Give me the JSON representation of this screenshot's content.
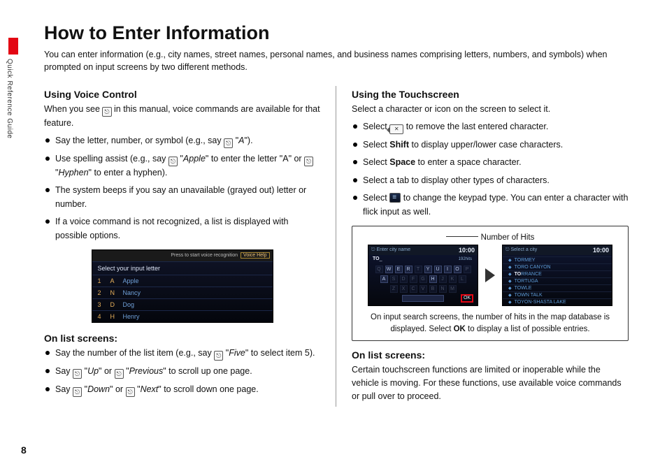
{
  "side_label": "Quick Reference Guide",
  "page_number": "8",
  "title": "How to Enter Information",
  "intro": "You can enter information (e.g., city names, street names, personal names, and business names comprising letters, numbers, and symbols) when prompted on input screens by two different methods.",
  "left": {
    "h_voice": "Using Voice Control",
    "voice_intro_a": "When you see ",
    "voice_intro_b": " in this manual, voice commands are available for that feature.",
    "b1_a": "Say the letter, number, or symbol (e.g., say ",
    "b1_cmd": "A",
    "b1_b": ").",
    "b2_a": "Use spelling assist (e.g., say ",
    "b2_cmd1": "Apple",
    "b2_b": " to enter the letter \"A\" or ",
    "b2_cmd2": "Hyphen",
    "b2_c": " to enter a hyphen).",
    "b3": "The system beeps if you say an unavailable (grayed out) letter or number.",
    "b4": "If a voice command is not recognized, a list is displayed with possible options.",
    "vc_top_msg": "Press      to start voice recognition",
    "vc_help": "Voice Help",
    "vc_head": "Select your input letter",
    "vc_rows": [
      {
        "n": "1",
        "l": "A",
        "w": "Apple"
      },
      {
        "n": "2",
        "l": "N",
        "w": "Nancy"
      },
      {
        "n": "3",
        "l": "D",
        "w": "Dog"
      },
      {
        "n": "4",
        "l": "H",
        "w": "Henry"
      }
    ],
    "h_list": "On list screens:",
    "l1_a": "Say the number of the list item (e.g., say ",
    "l1_cmd": "Five",
    "l1_b": " to select item 5).",
    "l2_a": "Say ",
    "l2_cmd1": "Up",
    "l2_b": " or ",
    "l2_cmd2": "Previous",
    "l2_c": " to scroll up one page.",
    "l3_a": "Say ",
    "l3_cmd1": "Down",
    "l3_b": " or ",
    "l3_cmd2": "Next",
    "l3_c": " to scroll down one page."
  },
  "right": {
    "h_touch": "Using the Touchscreen",
    "touch_intro": "Select a character or icon on the screen to select it.",
    "t1_a": "Select ",
    "t1_b": " to remove the last entered character.",
    "t2_a": "Select ",
    "t2_bold": "Shift",
    "t2_b": " to display upper/lower case characters.",
    "t3_a": "Select ",
    "t3_bold": "Space",
    "t3_b": " to enter a space character.",
    "t4": "Select a tab to display other types of characters.",
    "t5_a": "Select ",
    "t5_b": " to change the keypad type. You can enter a character with flick input as well.",
    "callout_label": "Number of Hits",
    "shot1_title": "Enter city name",
    "shot1_hits": "192hits",
    "shot1_time": "10:00",
    "shot1_entry": "TO",
    "kb_row1": [
      "Q",
      "W",
      "E",
      "R",
      "T",
      "Y",
      "U",
      "I",
      "O",
      "P"
    ],
    "kb_row2": [
      "A",
      "S",
      "D",
      "F",
      "G",
      "H",
      "J",
      "K",
      "L"
    ],
    "kb_row3": [
      "Z",
      "X",
      "C",
      "V",
      "B",
      "N",
      "M"
    ],
    "shot1_ok": "OK",
    "shot2_title": "Select a city",
    "shot2_time": "10:00",
    "shot2_rows": [
      "TORMEY",
      "TORO CANYON",
      "TORRANCE",
      "TORTUGA",
      "TOWLE",
      "TOWN TALK",
      "TOYON-SHASTA LAKE"
    ],
    "shot2_hi_pre": "TO",
    "shot2_hi_suf": "RRANCE",
    "callout_note_a": "On input search screens, the number of hits in the map database is displayed. Select ",
    "callout_note_bold": "OK",
    "callout_note_b": " to display a list of possible entries.",
    "h_list": "On list screens:",
    "list_note": "Certain touchscreen functions are limited or inoperable while the vehicle is moving. For these functions, use available voice commands or pull over to proceed."
  },
  "icons": {
    "voice": "⎋",
    "del": "✕"
  }
}
